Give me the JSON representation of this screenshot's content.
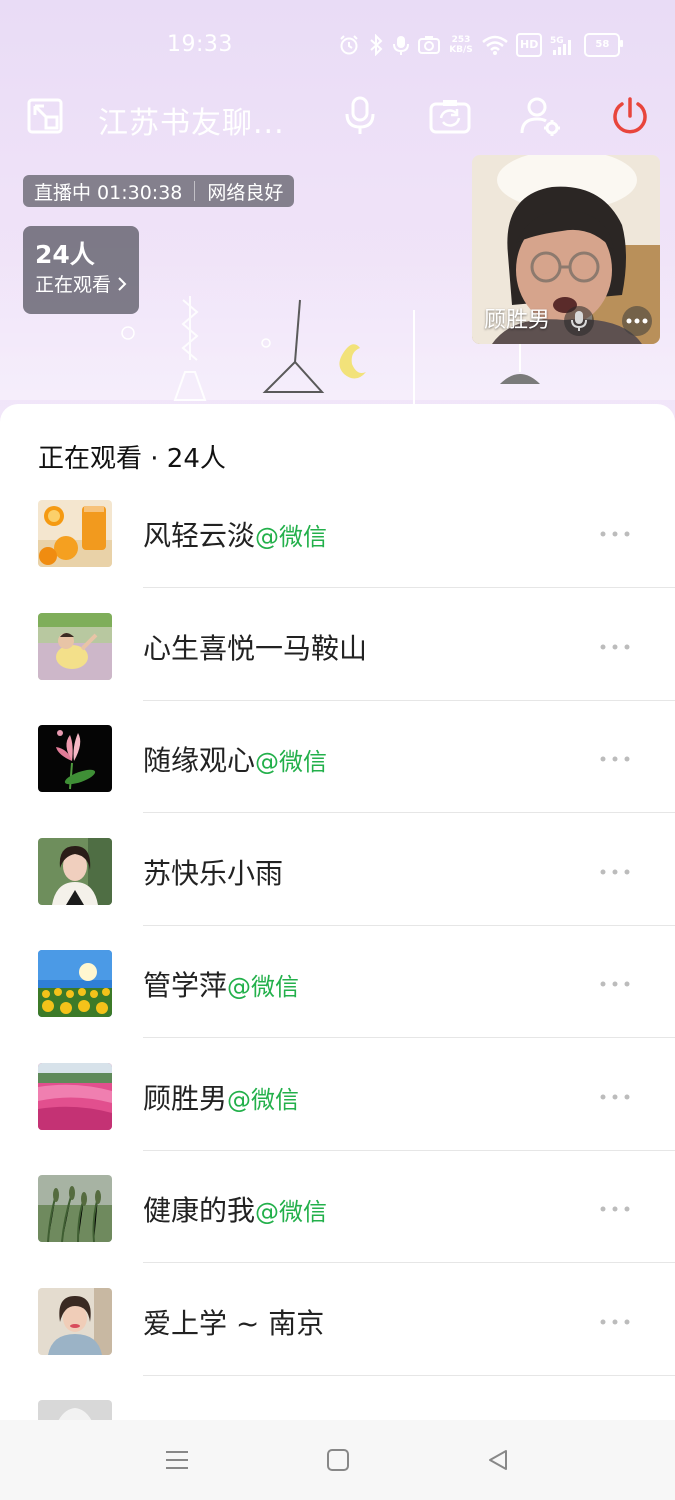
{
  "status_bar": {
    "time": "19:33",
    "net_speed": "253\nKB/S",
    "hd": "HD",
    "signal": "5G",
    "battery": "58"
  },
  "toolbar": {
    "room_title": "江苏书友聊..."
  },
  "live": {
    "status": "直播中 01:30:38",
    "network": "网络良好",
    "viewer_count": "24人",
    "viewer_label": "正在观看",
    "anchor_name": "顾胜男"
  },
  "sheet": {
    "title": "正在观看 · 24人",
    "members": [
      {
        "name": "风轻云淡",
        "tag": "@微信"
      },
      {
        "name": "心生喜悦一马鞍山",
        "tag": ""
      },
      {
        "name": "随缘观心",
        "tag": "@微信"
      },
      {
        "name": "苏快乐小雨",
        "tag": ""
      },
      {
        "name": "管学萍",
        "tag": "@微信"
      },
      {
        "name": "顾胜男",
        "tag": "@微信"
      },
      {
        "name": "健康的我",
        "tag": "@微信"
      },
      {
        "name": "爱上学 ~ 南京",
        "tag": ""
      }
    ]
  },
  "colors": {
    "accent_green": "#23b04b",
    "power_red": "#e8453c",
    "sheet_bg": "#ffffff",
    "live_bg": "#ece0f7"
  },
  "icons": {
    "toolbar": [
      "minimize-window-icon",
      "microphone-icon",
      "switch-camera-icon",
      "member-settings-icon",
      "power-icon"
    ],
    "nav": [
      "menu-icon",
      "home-icon",
      "back-icon"
    ]
  }
}
